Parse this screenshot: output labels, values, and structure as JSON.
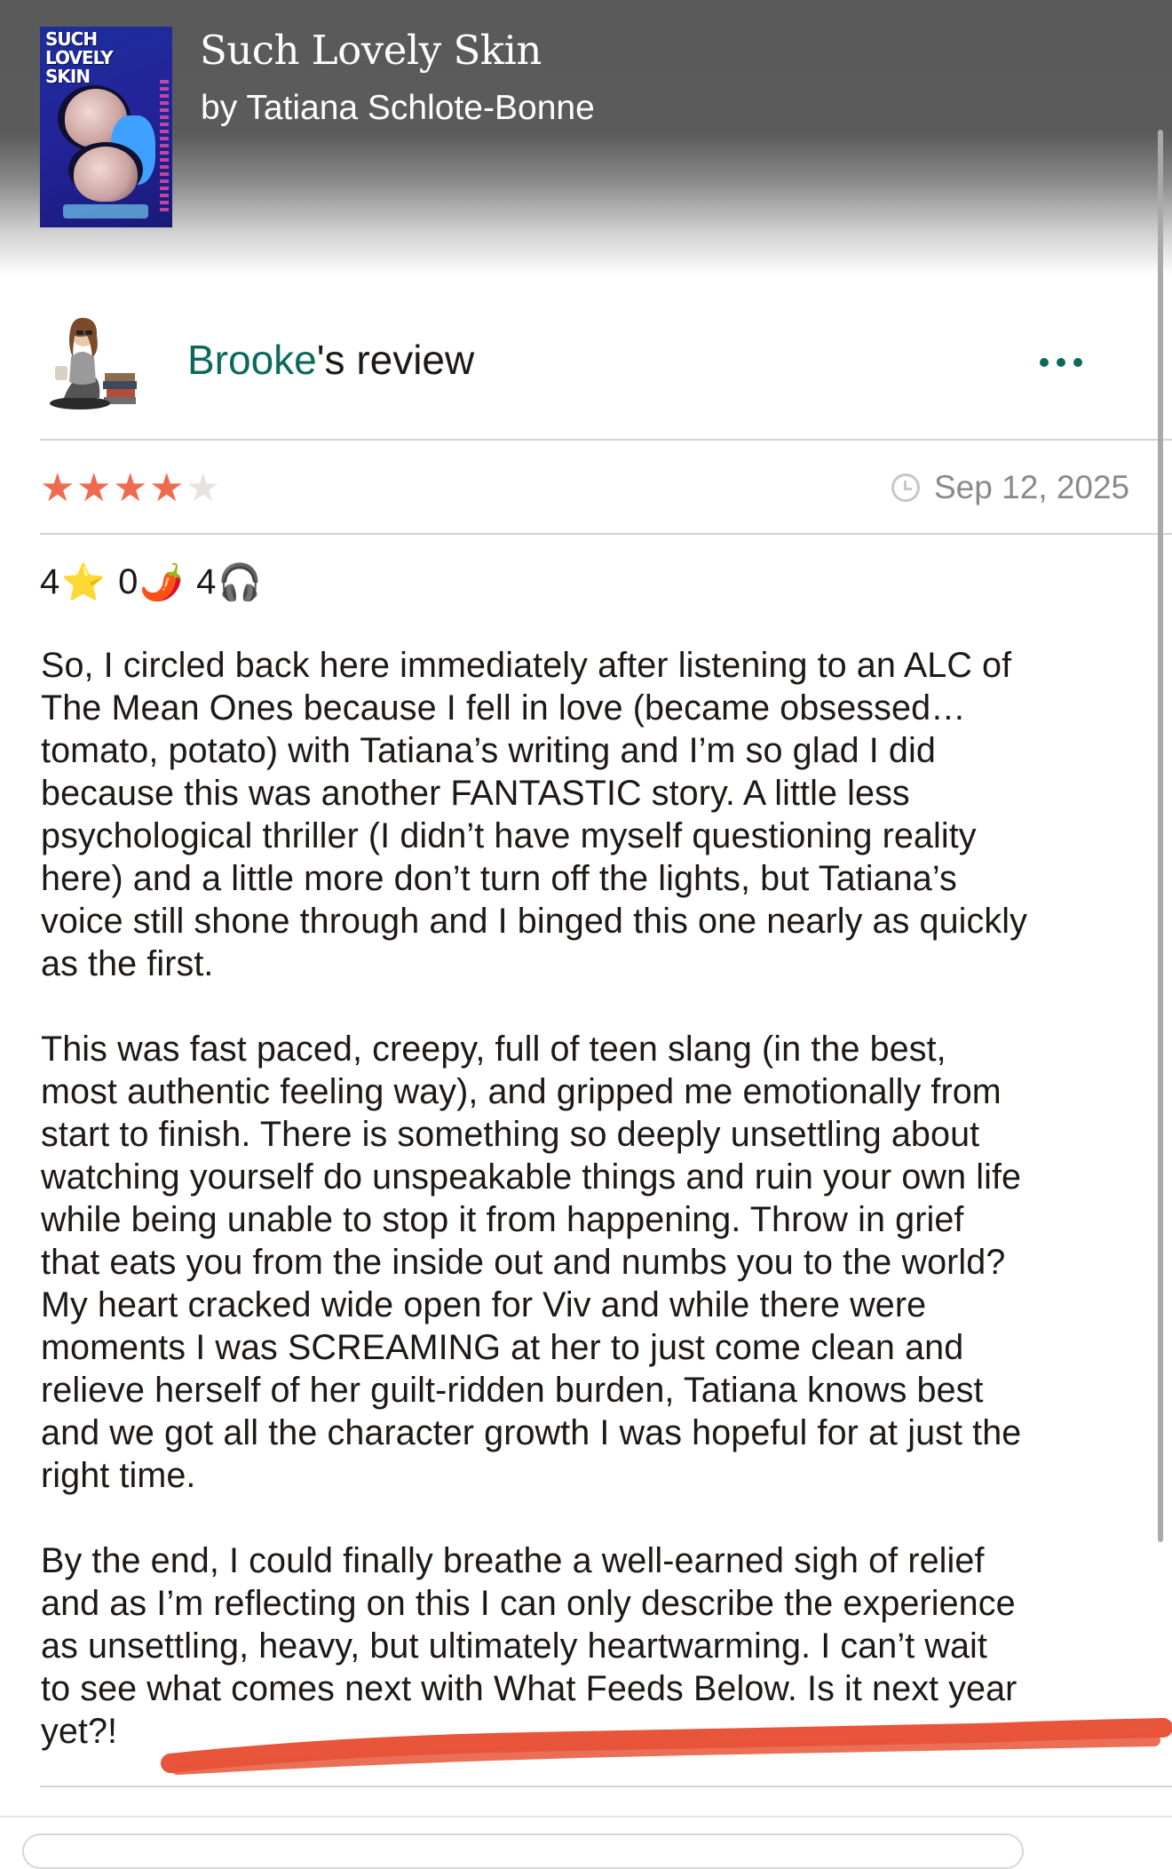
{
  "book": {
    "title": "Such Lovely Skin",
    "author": "by Tatiana Schlote-Bonne",
    "cover_text": "SUCH\nLOVELY\nSKIN"
  },
  "review_header": {
    "reviewer_name": "Brooke",
    "suffix": "'s review",
    "menu_icon": "ellipsis-icon"
  },
  "rating": {
    "stars": 4,
    "max_stars": 5,
    "star_color": "#f06a4e",
    "date": "Sep 12, 2025"
  },
  "emoji_ratings": [
    {
      "value": "4",
      "emoji": "⭐",
      "icon": "star-icon"
    },
    {
      "value": "0",
      "emoji": "🌶️",
      "icon": "chili-pepper-icon"
    },
    {
      "value": "4",
      "emoji": "🎧",
      "icon": "headphones-icon"
    }
  ],
  "review": {
    "paragraphs": [
      "So, I circled back here immediately after listening to an ALC of\nThe Mean Ones because I fell in love (became obsessed…\ntomato, potato) with Tatiana’s writing and I’m so glad I did\nbecause this was another FANTASTIC story. A little less\npsychological thriller (I didn’t have myself questioning reality\nhere) and a little more don’t turn off the lights, but Tatiana’s\nvoice still shone through and I binged this one nearly as quickly\nas the first.",
      "This was fast paced, creepy, full of teen slang (in the best,\nmost authentic feeling way), and gripped me emotionally from\nstart to finish. There is something so deeply unsettling about\nwatching yourself do unspeakable things and ruin your own life\nwhile being unable to stop it from happening. Throw in grief\nthat eats you from the inside out and numbs you to the world?\nMy heart cracked wide open for Viv and while there were\nmoments I was SCREAMING at her to just come clean and\nrelieve herself of her guilt-ridden burden, Tatiana knows best\nand we got all the character growth I was hopeful for at just the\nright time.",
      "By the end, I could finally breathe a well-earned sigh of relief\nand as I’m reflecting on this I can only describe the experience\nas unsettling, heavy, but ultimately heartwarming. I can’t wait\nto see what comes next with What Feeds Below. Is it next year\nyet?!"
    ]
  },
  "colors": {
    "accent_green": "#0b6a5c",
    "annotation_red": "#e8553a",
    "header_gray": "#5b5b5b"
  }
}
